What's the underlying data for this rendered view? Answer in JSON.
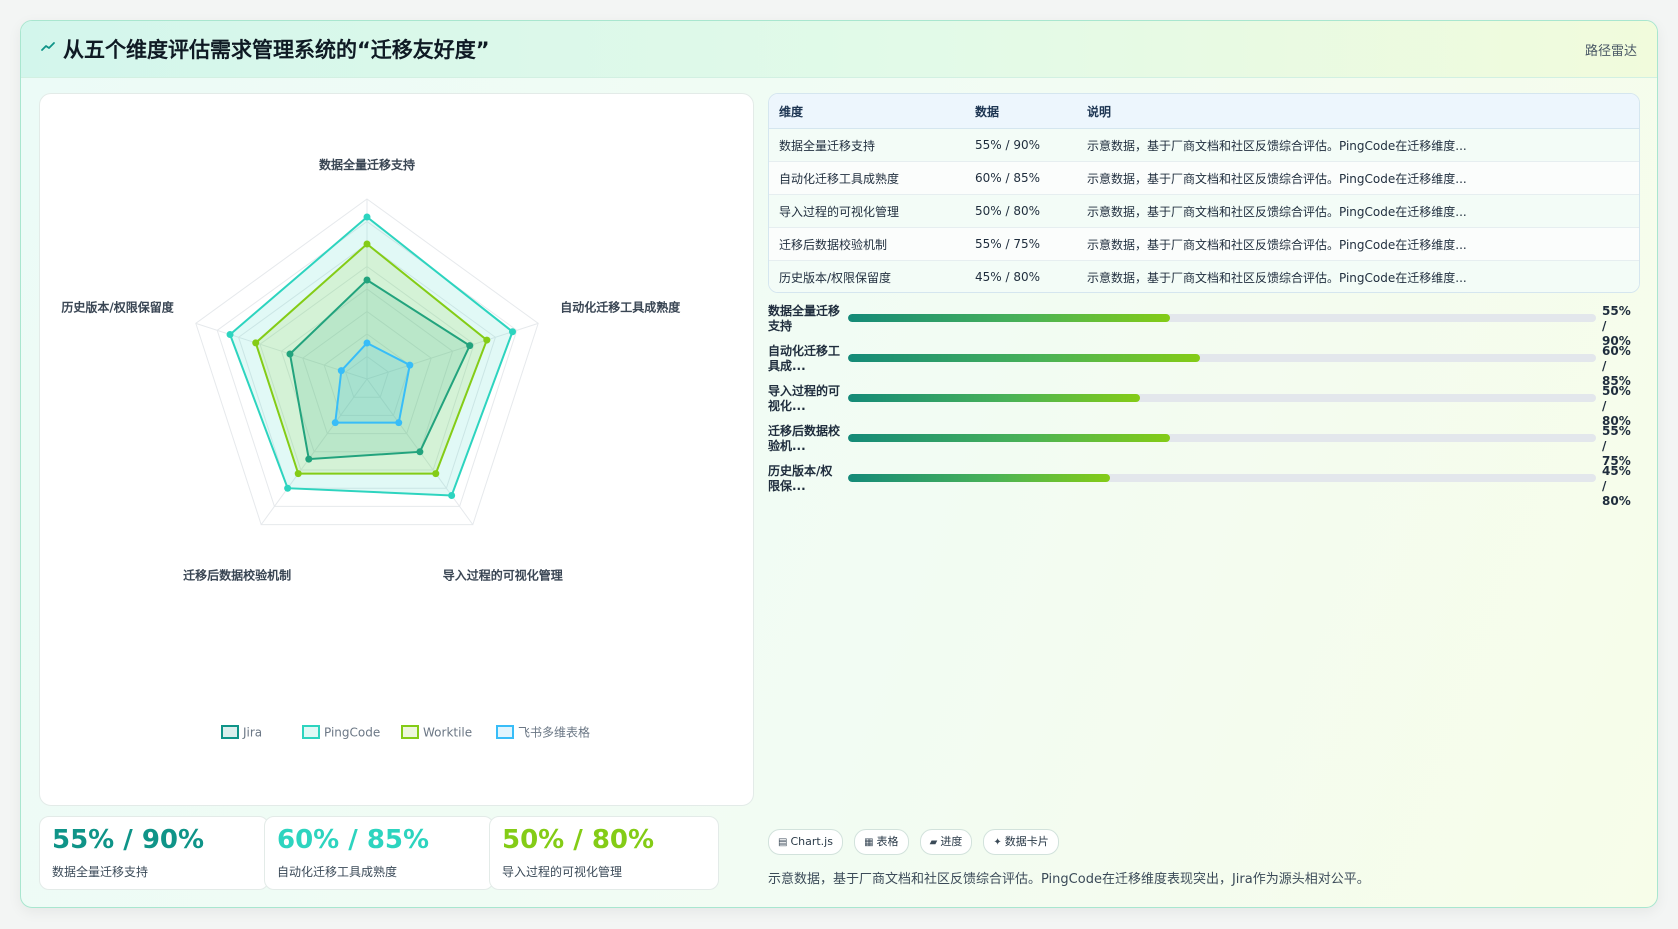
{
  "header": {
    "title": "从五个维度评估需求管理系统的“迁移友好度”",
    "tag": "路径雷达",
    "icon": "path-icon"
  },
  "colors": {
    "jira": "#0f9488",
    "pingcode": "#2dd4bf",
    "worktile": "#84cc16",
    "feishu": "#38bdf8"
  },
  "chart_data": {
    "type": "radar",
    "axes": [
      "数据全量迁移支持",
      "自动化迁移工具成熟度",
      "导入过程的可视化管理",
      "迁移后数据校验机制",
      "历史版本/权限保留度"
    ],
    "rlim": [
      0,
      100
    ],
    "grid": true,
    "legend_position": "bottom",
    "series": [
      {
        "name": "Jira",
        "values": [
          55,
          60,
          50,
          55,
          45
        ],
        "color": "#0f9488"
      },
      {
        "name": "PingCode",
        "values": [
          90,
          85,
          80,
          75,
          80
        ],
        "color": "#2dd4bf"
      },
      {
        "name": "Worktile",
        "values": [
          75,
          70,
          65,
          65,
          65
        ],
        "color": "#84cc16"
      },
      {
        "name": "飞书多维表格",
        "values": [
          20,
          25,
          30,
          30,
          15
        ],
        "color": "#38bdf8"
      }
    ]
  },
  "stats": [
    {
      "value": "55% / 90%",
      "label": "数据全量迁移支持",
      "color": "#0f9488"
    },
    {
      "value": "60% / 85%",
      "label": "自动化迁移工具成熟度",
      "color": "#2dd4bf"
    },
    {
      "value": "50% / 80%",
      "label": "导入过程的可视化管理",
      "color": "#84cc16"
    }
  ],
  "table": {
    "headers": [
      "维度",
      "数据",
      "说明"
    ],
    "rows": [
      [
        "数据全量迁移支持",
        "55% / 90%",
        "示意数据，基于厂商文档和社区反馈综合评估。PingCode在迁移维度..."
      ],
      [
        "自动化迁移工具成熟度",
        "60% / 85%",
        "示意数据，基于厂商文档和社区反馈综合评估。PingCode在迁移维度..."
      ],
      [
        "导入过程的可视化管理",
        "50% / 80%",
        "示意数据，基于厂商文档和社区反馈综合评估。PingCode在迁移维度..."
      ],
      [
        "迁移后数据校验机制",
        "55% / 75%",
        "示意数据，基于厂商文档和社区反馈综合评估。PingCode在迁移维度..."
      ],
      [
        "历史版本/权限保留度",
        "45% / 80%",
        "示意数据，基于厂商文档和社区反馈综合评估。PingCode在迁移维度..."
      ]
    ]
  },
  "progress": [
    {
      "label": "数据全量迁移支持",
      "value": "55% / 90%",
      "percent": 43
    },
    {
      "label": "自动化迁移工具成...",
      "value": "60% / 85%",
      "percent": 47
    },
    {
      "label": "导入过程的可视化...",
      "value": "50% / 80%",
      "percent": 39
    },
    {
      "label": "迁移后数据校验机...",
      "value": "55% / 75%",
      "percent": 43
    },
    {
      "label": "历史版本/权限保...",
      "value": "45% / 80%",
      "percent": 35
    }
  ],
  "chips": [
    {
      "icon": "chart-icon",
      "glyph": "▤",
      "label": "Chart.js"
    },
    {
      "icon": "table-icon",
      "glyph": "▦",
      "label": "表格"
    },
    {
      "icon": "progress-icon",
      "glyph": "▰",
      "label": "进度"
    },
    {
      "icon": "card-icon",
      "glyph": "✦",
      "label": "数据卡片"
    }
  ],
  "footnote": "示意数据，基于厂商文档和社区反馈综合评估。PingCode在迁移维度表现突出，Jira作为源头相对公平。"
}
